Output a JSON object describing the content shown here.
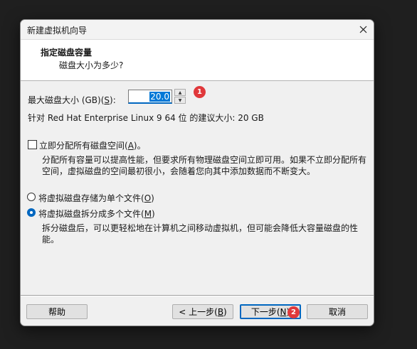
{
  "window": {
    "title": "新建虚拟机向导",
    "close_icon": "close-icon"
  },
  "header": {
    "title": "指定磁盘容量",
    "subtitle": "磁盘大小为多少?"
  },
  "disk_size": {
    "label_prefix": "最大磁盘大小 (GB)(",
    "label_key": "S",
    "label_suffix": "):",
    "value": "20.0"
  },
  "recommendation": "针对 Red Hat Enterprise Linux 9 64 位 的建议大小: 20 GB",
  "allocate_now": {
    "checked": false,
    "label_prefix": "立即分配所有磁盘空间(",
    "label_key": "A",
    "label_suffix": ")。",
    "description": "分配所有容量可以提高性能，但要求所有物理磁盘空间立即可用。如果不立即分配所有空间，虚拟磁盘的空间最初很小，会随着您向其中添加数据而不断变大。"
  },
  "storage_options": [
    {
      "label_prefix": "将虚拟磁盘存储为单个文件(",
      "label_key": "O",
      "label_suffix": ")",
      "selected": false
    },
    {
      "label_prefix": "将虚拟磁盘拆分成多个文件(",
      "label_key": "M",
      "label_suffix": ")",
      "selected": true
    }
  ],
  "split_description": "拆分磁盘后，可以更轻松地在计算机之间移动虚拟机，但可能会降低大容量磁盘的性能。",
  "buttons": {
    "help": "帮助",
    "back_prefix": "< 上一步(",
    "back_key": "B",
    "back_suffix": ")",
    "next_prefix": "下一步(",
    "next_key": "N",
    "next_suffix": ")",
    "cancel": "取消"
  },
  "annotations": [
    "1",
    "2"
  ],
  "colors": {
    "accent": "#0067c0",
    "badge": "#e0383b",
    "background": "#1f1f1f"
  }
}
